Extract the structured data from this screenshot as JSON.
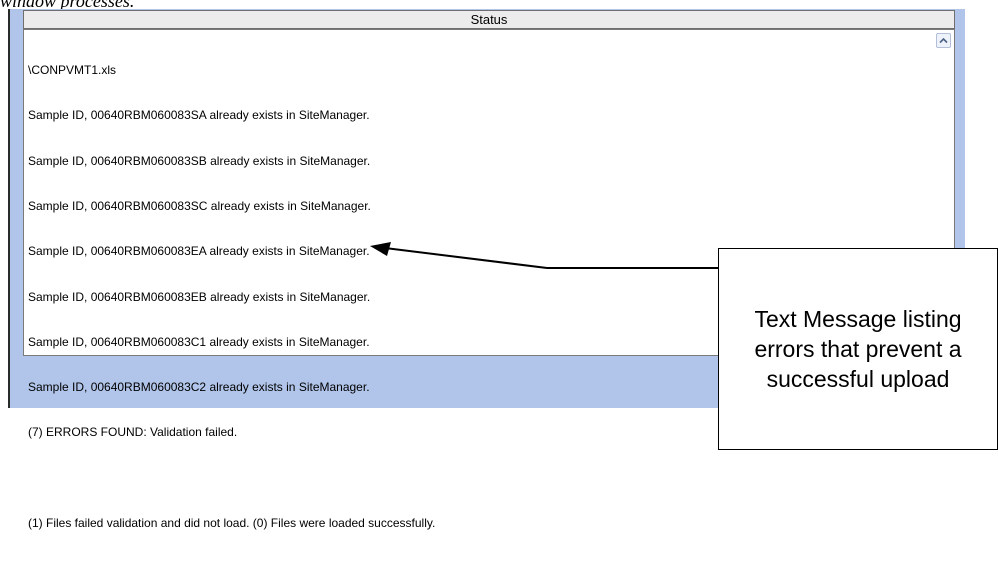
{
  "document": {
    "caption_fragment": "window processes."
  },
  "status_window": {
    "header_title": "Status",
    "log_lines": [
      "\\CONPVMT1.xls",
      "Sample ID, 00640RBM060083SA already exists in SiteManager.",
      "Sample ID, 00640RBM060083SB already exists in SiteManager.",
      "Sample ID, 00640RBM060083SC already exists in SiteManager.",
      "Sample ID, 00640RBM060083EA already exists in SiteManager.",
      "Sample ID, 00640RBM060083EB already exists in SiteManager.",
      "Sample ID, 00640RBM060083C1 already exists in SiteManager.",
      "Sample ID, 00640RBM060083C2 already exists in SiteManager.",
      "(7) ERRORS FOUND: Validation failed.",
      "",
      "(1) Files failed validation and did not load. (0) Files were loaded successfully."
    ],
    "scrollbar_icon": "chevron-up-icon"
  },
  "callout": {
    "text": "Text Message listing errors that prevent a successful upload"
  },
  "colors": {
    "frame_background": "#b1c5ea",
    "header_background": "#ececec"
  }
}
